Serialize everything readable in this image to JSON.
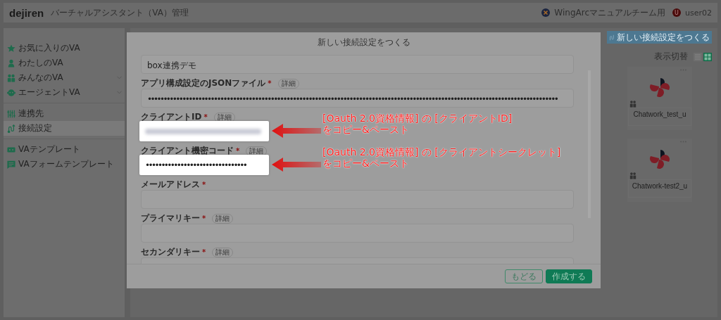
{
  "header": {
    "logo": "dejiren",
    "app_title": "バーチャルアシスタント（VA）管理",
    "team": "WingArcマニュアルチーム用",
    "user_initial": "U",
    "user": "user02"
  },
  "sidebar": {
    "groups": [
      [
        {
          "kind": "star",
          "label": "お気に入りのVA",
          "selected": false,
          "expandable": false
        },
        {
          "kind": "person",
          "label": "わたしのVA",
          "selected": false,
          "expandable": false
        },
        {
          "kind": "people",
          "label": "みんなのVA",
          "selected": false,
          "expandable": true
        },
        {
          "kind": "robot",
          "label": "エージェントVA",
          "selected": false,
          "expandable": true
        }
      ],
      [
        {
          "kind": "sliders",
          "label": "連携先",
          "selected": false,
          "expandable": false
        },
        {
          "kind": "connect",
          "label": "接続設定",
          "selected": true,
          "expandable": false
        }
      ],
      [
        {
          "kind": "template",
          "label": "VAテンプレート",
          "selected": false,
          "expandable": false
        },
        {
          "kind": "form",
          "label": "VAフォームテンプレート",
          "selected": false,
          "expandable": false
        }
      ]
    ]
  },
  "toolbar": {
    "new_button": "新しい接続設定をつくる",
    "view_label": "表示切替",
    "view_modes": [
      {
        "kind": "list",
        "selected": false
      },
      {
        "kind": "grid",
        "selected": true
      }
    ]
  },
  "cards": [
    {
      "name": "Chatwork_test_u"
    },
    {
      "name": "Chatwork-test2_u"
    }
  ],
  "modal": {
    "title": "新しい接続設定をつくる",
    "fields": [
      {
        "kind": "text",
        "value": "box連携デモ",
        "highlighted": false
      },
      {
        "kind": "text",
        "label": "アプリ構成設定のJSONファイル",
        "required_mark": "*",
        "detail": "詳細",
        "value": "••••••••••••••••••••••••••••••••••••••••••••••••••••••••••••••••••••••••••••••••••••••••••••••••••••••••••••••••••••••••••••••••••",
        "highlighted": false
      },
      {
        "kind": "blurred",
        "label": "クライアントID",
        "required_mark": "*",
        "detail": "詳細",
        "highlighted": true,
        "callout": [
          "[Oauth 2.0資格情報] の [クライアントID]",
          "をコピー&ペースト"
        ]
      },
      {
        "kind": "text",
        "label": "クライアント機密コード",
        "required_mark": "*",
        "detail": "詳細",
        "value": "••••••••••••••••••••••••••••••••",
        "highlighted": true,
        "callout": [
          "[Oauth 2.0資格情報] の [クライアントシークレット]",
          "をコピー&ペースト"
        ]
      },
      {
        "kind": "text",
        "label": "メールアドレス",
        "required_mark": "*",
        "highlighted": false
      },
      {
        "kind": "text",
        "label": "プライマリキー",
        "required_mark": "*",
        "detail": "詳細",
        "highlighted": false
      },
      {
        "kind": "text",
        "label": "セカンダリキー",
        "required_mark": "*",
        "detail": "詳細",
        "highlighted": false
      }
    ],
    "buttons": [
      {
        "kind": "secondary",
        "label": "もどる"
      },
      {
        "kind": "primary",
        "label": "作成する"
      }
    ]
  }
}
